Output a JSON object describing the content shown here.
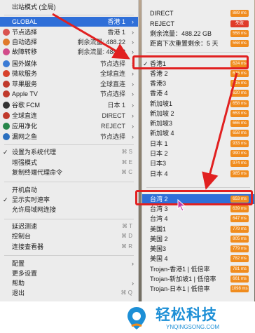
{
  "left_menu": {
    "items": [
      {
        "label": "出站模式 (全局)",
        "chk": "",
        "sep": false
      },
      {
        "label": "GLOBAL",
        "value": "香港 1",
        "arrow": "›",
        "selected": true
      },
      {
        "label": "节点选择",
        "value": "香港 1",
        "arrow": "›",
        "icon": "pin-icon",
        "icolor": "#d9534f"
      },
      {
        "label": "自动选择",
        "value": "剩余流量: 488.22",
        "arrow": "›",
        "icon": "auto-icon",
        "icolor": "#e07a2b"
      },
      {
        "label": "故障转移",
        "value": "剩余流量: 488.22",
        "arrow": "›",
        "icon": "failover-icon",
        "icolor": "#d24b8a"
      },
      {
        "label": "国外媒体",
        "value": "节点选择",
        "arrow": "›",
        "icon": "globe-icon",
        "icolor": "#3a7bd5"
      },
      {
        "label": "微软服务",
        "value": "全球直连",
        "arrow": "›",
        "icon": "microsoft-icon",
        "icolor": "#d7412b"
      },
      {
        "label": "苹果服务",
        "value": "全球直连",
        "arrow": "›",
        "icon": "apple-icon",
        "icolor": "#c0392b"
      },
      {
        "label": "Apple TV",
        "value": "节点选择",
        "arrow": "›",
        "icon": "appletv-icon",
        "icolor": "#c0392b"
      },
      {
        "label": "谷歌 FCM",
        "value": "日本 1",
        "arrow": "›",
        "icon": "google-icon",
        "icolor": "#333333"
      },
      {
        "label": "全球直连",
        "value": "DIRECT",
        "arrow": "›",
        "icon": "direct-icon",
        "icolor": "#c0392b"
      },
      {
        "label": "应用净化",
        "value": "REJECT",
        "arrow": "›",
        "icon": "shield-icon",
        "icolor": "#27864a"
      },
      {
        "label": "漏网之鱼",
        "value": "节点选择",
        "arrow": "›",
        "icon": "fish-icon",
        "icolor": "#2a6fbf"
      }
    ],
    "system": [
      {
        "chk": "✓",
        "label": "设置为系统代理",
        "shortcut": "⌘ S"
      },
      {
        "chk": "",
        "label": "增强模式",
        "shortcut": "⌘ E"
      },
      {
        "chk": "",
        "label": "复制终端代理命令",
        "shortcut": "⌘ C"
      }
    ],
    "startup": [
      {
        "chk": "",
        "label": "开机启动",
        "shortcut": ""
      },
      {
        "chk": "✓",
        "label": "显示实时速率",
        "shortcut": ""
      },
      {
        "chk": "",
        "label": "允许局域网连接",
        "shortcut": ""
      }
    ],
    "tools": [
      {
        "label": "延迟测速",
        "shortcut": "⌘ T"
      },
      {
        "label": "控制台",
        "shortcut": "⌘ D"
      },
      {
        "label": "连接查看器",
        "shortcut": "⌘ R"
      }
    ],
    "bottom": [
      {
        "label": "配置",
        "arrow": "›"
      },
      {
        "label": "更多设置",
        "arrow": ""
      },
      {
        "label": "帮助",
        "arrow": "›"
      },
      {
        "label": "退出",
        "shortcut": "⌘ Q"
      }
    ]
  },
  "sub_menu": {
    "items": [
      {
        "label": "DIRECT",
        "latency": "889 ms"
      },
      {
        "label": "REJECT",
        "latency": "失败",
        "red": true
      },
      {
        "label": "剩余流量：488.22 GB",
        "latency": "558 ms"
      },
      {
        "label": "距离下次重置剩余：5 天",
        "latency": "558 ms"
      },
      {
        "label": "香港1",
        "latency": "624 ms",
        "checked": true
      },
      {
        "label": "香港 2",
        "latency": "615 ms"
      },
      {
        "label": "香港3",
        "latency": "615 ms"
      },
      {
        "label": "香港 4",
        "latency": "620 ms"
      },
      {
        "label": "新加坡1",
        "latency": "658 ms"
      },
      {
        "label": "新加坡 2",
        "latency": "653 ms"
      },
      {
        "label": "新加坡3",
        "latency": "666 ms"
      },
      {
        "label": "新加坡 4",
        "latency": "658 ms"
      },
      {
        "label": "日本 1",
        "latency": "933 ms"
      },
      {
        "label": "日本 2",
        "latency": "990 ms"
      },
      {
        "label": "日本3",
        "latency": "974 ms"
      },
      {
        "label": "日本 4",
        "latency": "985 ms"
      },
      {
        "label": "台湾 2",
        "latency": "653 ms",
        "highlight": true
      },
      {
        "label": "台湾 3",
        "latency": "639 ms"
      },
      {
        "label": "台湾 4",
        "latency": "647 ms"
      },
      {
        "label": "美国1",
        "latency": "779 ms"
      },
      {
        "label": "美国 2",
        "latency": "805 ms"
      },
      {
        "label": "美国3",
        "latency": "779 ms"
      },
      {
        "label": "美国 4",
        "latency": "782 ms"
      },
      {
        "label": "Trojan-香港1 | 低倍率",
        "latency": "781 ms"
      },
      {
        "label": "Trojan-新加坡1 | 低倍率",
        "latency": "661 ms"
      },
      {
        "label": "Trojan-日本1 | 低倍率",
        "latency": "1098 ms"
      }
    ]
  },
  "watermark": {
    "title": "轻松科技",
    "subtitle": "YNQINGSONG.COM"
  },
  "colors": {
    "selected": "#2f6fd8",
    "latency": "#f08c1e",
    "fail": "#e03b2a",
    "annotation": "#e12020",
    "brand": "#1d8fd6"
  }
}
